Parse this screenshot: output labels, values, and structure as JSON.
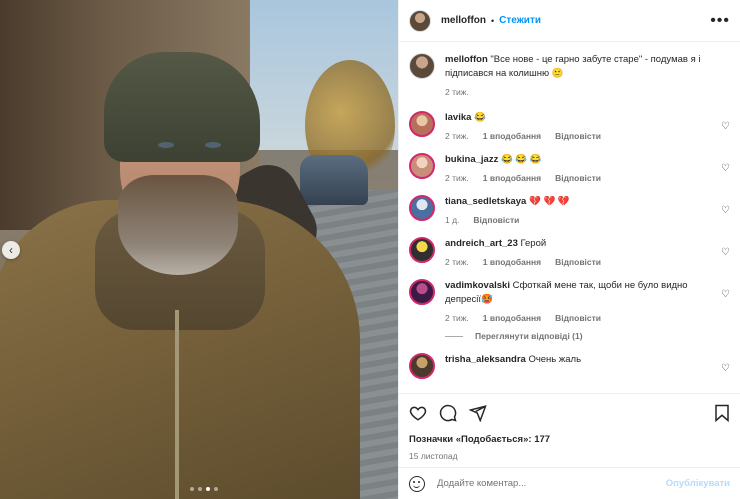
{
  "post": {
    "author": "melloffon",
    "separator": "•",
    "follow_label": "Стежити",
    "more_icon": "more-options-icon",
    "photo_dots": 4,
    "active_dot": 3
  },
  "caption": {
    "username": "melloffon",
    "text": "\"Все нове - це гарно забуте старе\" - подумав я і підписався на колишню 🙂",
    "time": "2 тиж."
  },
  "comments": [
    {
      "username": "lavika",
      "text": "😂",
      "time": "2 тиж.",
      "likes": "1 вподобання",
      "reply": "Відповісти"
    },
    {
      "username": "bukina_jazz",
      "text": "😂 😂 😂",
      "time": "2 тиж.",
      "likes": "1 вподобання",
      "reply": "Відповісти"
    },
    {
      "username": "tiana_sedletskaya",
      "text": "💔 💔 💔",
      "time": "1 д.",
      "likes": "",
      "reply": "Відповісти"
    },
    {
      "username": "andreich_art_23",
      "text": "Герой",
      "time": "2 тиж.",
      "likes": "1 вподобання",
      "reply": "Відповісти"
    },
    {
      "username": "vadimkovalski",
      "text": "Сфоткай мене так, щоби не було видно депресії🥵",
      "time": "2 тиж.",
      "likes": "1 вподобання",
      "reply": "Відповісти"
    },
    {
      "username": "trisha_aleksandra",
      "text": "Очень жаль",
      "time": "",
      "likes": "",
      "reply": ""
    }
  ],
  "view_replies": "Переглянути відповіді (1)",
  "actions": {
    "icons": [
      "heart-icon",
      "comment-icon",
      "share-icon",
      "bookmark-icon"
    ]
  },
  "likes_text": "Позначки «Подобається»: 177",
  "date": "15 листопад",
  "add_comment": {
    "placeholder": "Додайте коментар...",
    "publish_label": "Опублікувати"
  },
  "colors": {
    "accent": "#0095f6",
    "publish_disabled": "#b3dbff",
    "story_ring": "#d1286b"
  }
}
